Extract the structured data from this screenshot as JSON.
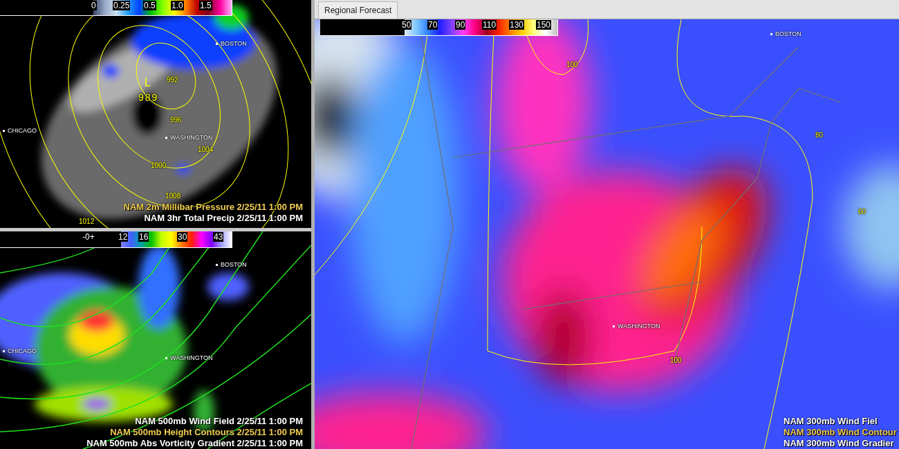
{
  "panels": [
    {
      "kind": "precip",
      "colorbar": {
        "ticks": [
          "0",
          "0.25",
          "0.5",
          "1.0",
          "1.5"
        ]
      },
      "pressure_low": {
        "symbol": "L",
        "value": "989"
      },
      "labels": [
        {
          "text": "BOSTON",
          "kind": "city"
        },
        {
          "text": "CHICAGO",
          "kind": "city"
        },
        {
          "text": "WASHINGTON",
          "kind": "city"
        },
        {
          "text": "992",
          "kind": "contour"
        },
        {
          "text": "996",
          "kind": "contour"
        },
        {
          "text": "1004",
          "kind": "contour"
        },
        {
          "text": "1000",
          "kind": "contour"
        },
        {
          "text": "1008",
          "kind": "contour"
        },
        {
          "text": "1012",
          "kind": "contour"
        }
      ],
      "legend": [
        {
          "text": "NAM 2m Millibar Pressure 2/25/11 1:00 PM",
          "color": "#f0cc50"
        },
        {
          "text": "NAM 3hr Total Precip 2/25/11 1:00 PM",
          "color": "#ffffff"
        }
      ]
    },
    {
      "kind": "vorticity",
      "colorbar": {
        "ticks": [
          "-0+",
          "12",
          "16",
          "30",
          "43"
        ]
      },
      "labels": [
        {
          "text": "BOSTON",
          "kind": "city"
        },
        {
          "text": "CHICAGO",
          "kind": "city"
        },
        {
          "text": "WASHINGTON",
          "kind": "city"
        }
      ],
      "legend": [
        {
          "text": "NAM 500mb Wind Field 2/25/11 1:00 PM",
          "color": "#ffffff"
        },
        {
          "text": "NAM 500mb Height Contours 2/25/11 1:00 PM",
          "color": "#f0cc50"
        },
        {
          "text": "NAM 500mb Abs Vorticity Gradient 2/25/11 1:00 PM",
          "color": "#ffffff"
        }
      ]
    }
  ],
  "right_panel": {
    "tab": {
      "label": "Regional Forecast",
      "selected": true
    },
    "map": {
      "kind": "jet",
      "colorbar": {
        "ticks": [
          "50",
          "70",
          "90",
          "110",
          "130",
          "150"
        ]
      },
      "labels": [
        {
          "text": "BOSTON",
          "kind": "city"
        },
        {
          "text": "WASHINGTON",
          "kind": "city"
        },
        {
          "text": "100",
          "kind": "contour"
        },
        {
          "text": "80",
          "kind": "contour"
        },
        {
          "text": "60",
          "kind": "contour"
        },
        {
          "text": "100",
          "kind": "contour"
        }
      ],
      "legend": [
        {
          "text": "NAM 300mb Wind Fiel",
          "color": "#ffffff"
        },
        {
          "text": "NAM 300mb Wind Contour",
          "color": "#f0cc50"
        },
        {
          "text": "NAM 300mb Wind Gradier",
          "color": "#ffffff"
        }
      ]
    }
  }
}
